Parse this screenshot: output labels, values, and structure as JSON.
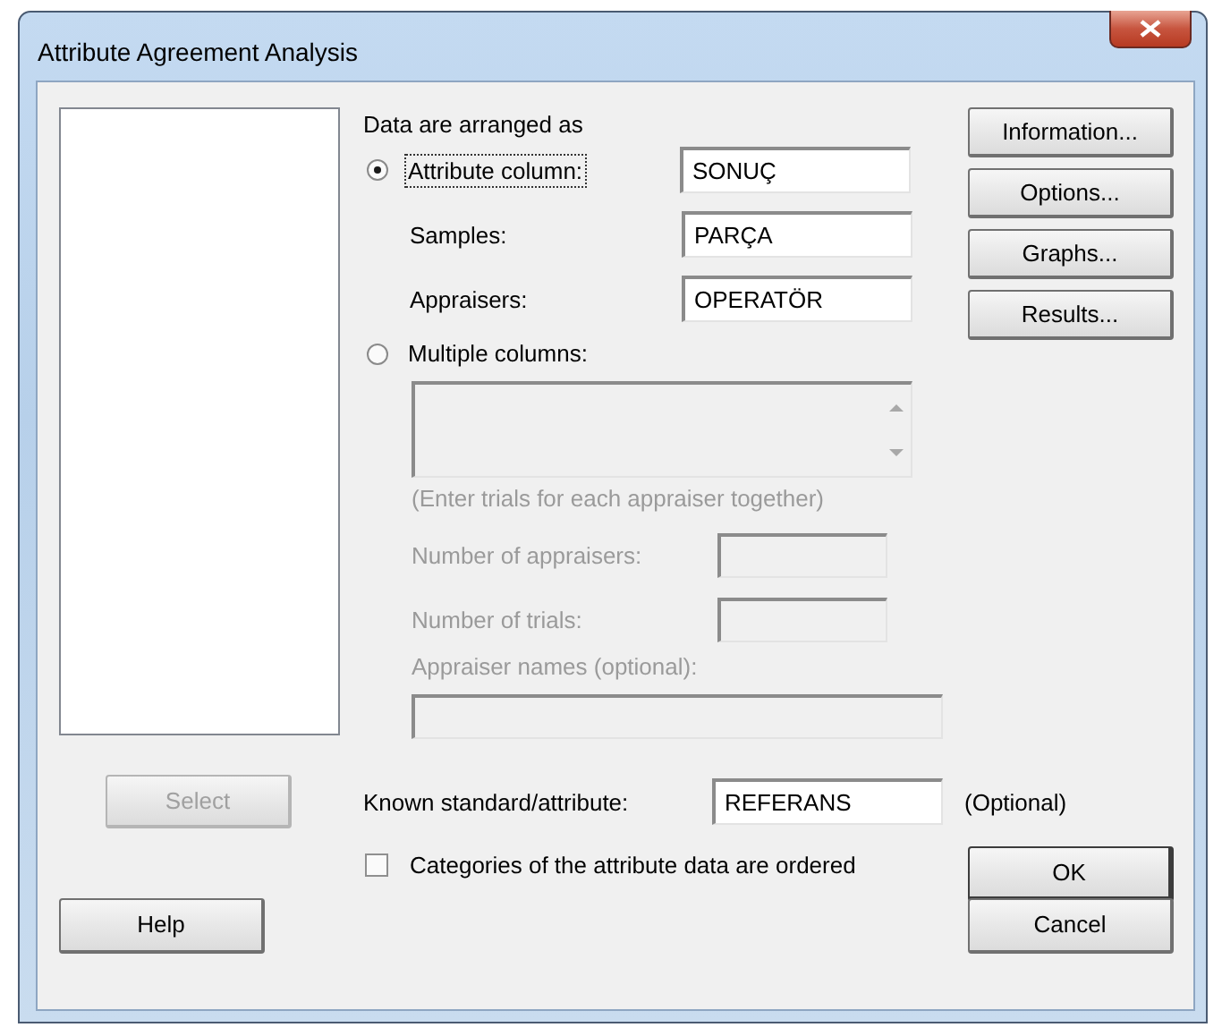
{
  "window": {
    "title": "Attribute Agreement Analysis"
  },
  "variable_list": {
    "select_button": {
      "label": "Select",
      "disabled": true
    }
  },
  "arrangement": {
    "heading": "Data are arranged as",
    "attribute_column": {
      "label": "Attribute column:",
      "selected": true,
      "focused": true,
      "value": "SONUÇ"
    },
    "samples": {
      "label": "Samples:",
      "value": "PARÇA"
    },
    "appraisers": {
      "label": "Appraisers:",
      "value": "OPERATÖR"
    },
    "multiple_columns": {
      "label": "Multiple columns:",
      "selected": false,
      "disabled": true,
      "note": "(Enter trials for each appraiser together)",
      "number_of_appraisers": {
        "label": "Number of appraisers:"
      },
      "number_of_trials": {
        "label": "Number of trials:"
      },
      "appraiser_names": {
        "label": "Appraiser names (optional):"
      }
    }
  },
  "side_buttons": [
    {
      "label": "Information..."
    },
    {
      "label": "Options..."
    },
    {
      "label": "Graphs..."
    },
    {
      "label": "Results..."
    }
  ],
  "known_standard": {
    "label": "Known standard/attribute:",
    "value": "REFERANS",
    "note": "(Optional)"
  },
  "ordered_categories": {
    "label": "Categories of the attribute data are ordered",
    "checked": false
  },
  "ok_button": {
    "label": "OK",
    "default": true
  },
  "cancel_button": {
    "label": "Cancel",
    "default": false
  },
  "help_button": {
    "label": "Help"
  }
}
